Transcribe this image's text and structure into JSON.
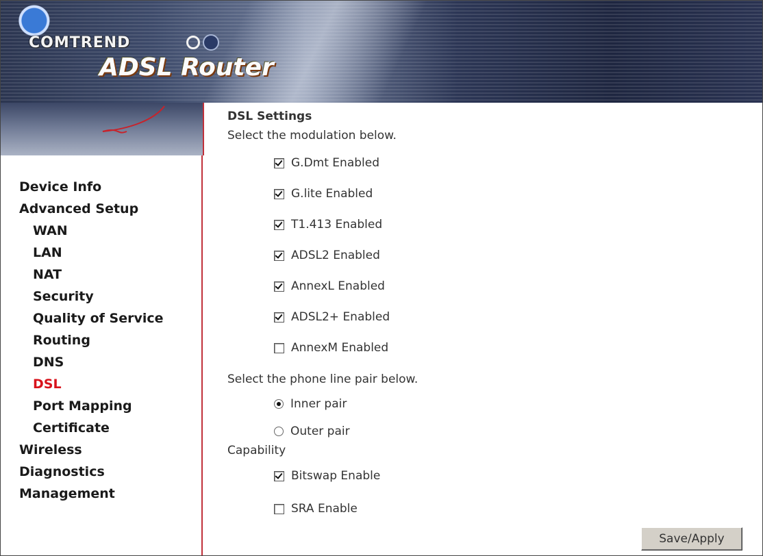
{
  "header": {
    "brand": "COMTREND",
    "product": "ADSL Router"
  },
  "sidebar": {
    "items": [
      {
        "label": "Device Info",
        "level": 0,
        "active": false
      },
      {
        "label": "Advanced Setup",
        "level": 0,
        "active": false
      },
      {
        "label": "WAN",
        "level": 1,
        "active": false
      },
      {
        "label": "LAN",
        "level": 1,
        "active": false
      },
      {
        "label": "NAT",
        "level": 1,
        "active": false
      },
      {
        "label": "Security",
        "level": 1,
        "active": false
      },
      {
        "label": "Quality of Service",
        "level": 1,
        "active": false
      },
      {
        "label": "Routing",
        "level": 1,
        "active": false
      },
      {
        "label": "DNS",
        "level": 1,
        "active": false
      },
      {
        "label": "DSL",
        "level": 1,
        "active": true
      },
      {
        "label": "Port Mapping",
        "level": 1,
        "active": false
      },
      {
        "label": "Certificate",
        "level": 1,
        "active": false
      },
      {
        "label": "Wireless",
        "level": 0,
        "active": false
      },
      {
        "label": "Diagnostics",
        "level": 0,
        "active": false
      },
      {
        "label": "Management",
        "level": 0,
        "active": false
      }
    ]
  },
  "main": {
    "title": "DSL Settings",
    "modulation_prompt": "Select the modulation below.",
    "modulations": [
      {
        "label": "G.Dmt Enabled",
        "checked": true
      },
      {
        "label": "G.lite Enabled",
        "checked": true
      },
      {
        "label": "T1.413 Enabled",
        "checked": true
      },
      {
        "label": "ADSL2 Enabled",
        "checked": true
      },
      {
        "label": "AnnexL Enabled",
        "checked": true
      },
      {
        "label": "ADSL2+ Enabled",
        "checked": true
      },
      {
        "label": "AnnexM Enabled",
        "checked": false
      }
    ],
    "pair_prompt": "Select the phone line pair below.",
    "pairs": [
      {
        "label": "Inner pair",
        "selected": true
      },
      {
        "label": "Outer pair",
        "selected": false
      }
    ],
    "capability_label": "Capability",
    "capabilities": [
      {
        "label": "Bitswap Enable",
        "checked": true
      },
      {
        "label": "SRA Enable",
        "checked": false
      }
    ],
    "save_label": "Save/Apply"
  },
  "colors": {
    "active_nav": "#d8131c",
    "sidebar_border": "#c0303a"
  }
}
